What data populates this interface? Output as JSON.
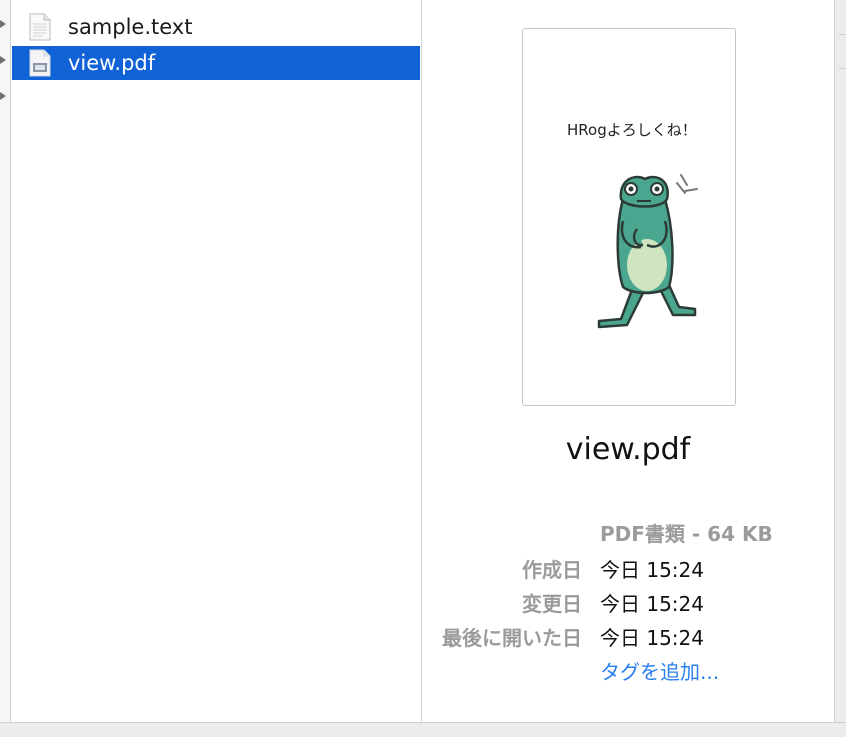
{
  "files": [
    {
      "name": "sample.text",
      "icon": "text-document-icon",
      "selected": false
    },
    {
      "name": "view.pdf",
      "icon": "pdf-document-icon",
      "selected": true
    }
  ],
  "preview": {
    "thumbnail_caption": "HRogよろしくね！",
    "title": "view.pdf",
    "kind": "PDF書類 - 64 KB",
    "meta": [
      {
        "label": "作成日",
        "value": "今日 15:24"
      },
      {
        "label": "変更日",
        "value": "今日 15:24"
      },
      {
        "label": "最後に開いた日",
        "value": "今日 15:24"
      }
    ],
    "add_tag": "タグを追加..."
  },
  "colors": {
    "selection": "#1262d7",
    "link": "#2a7ff0",
    "frog": "#4aa68f",
    "frog_belly": "#cfe5c0"
  }
}
